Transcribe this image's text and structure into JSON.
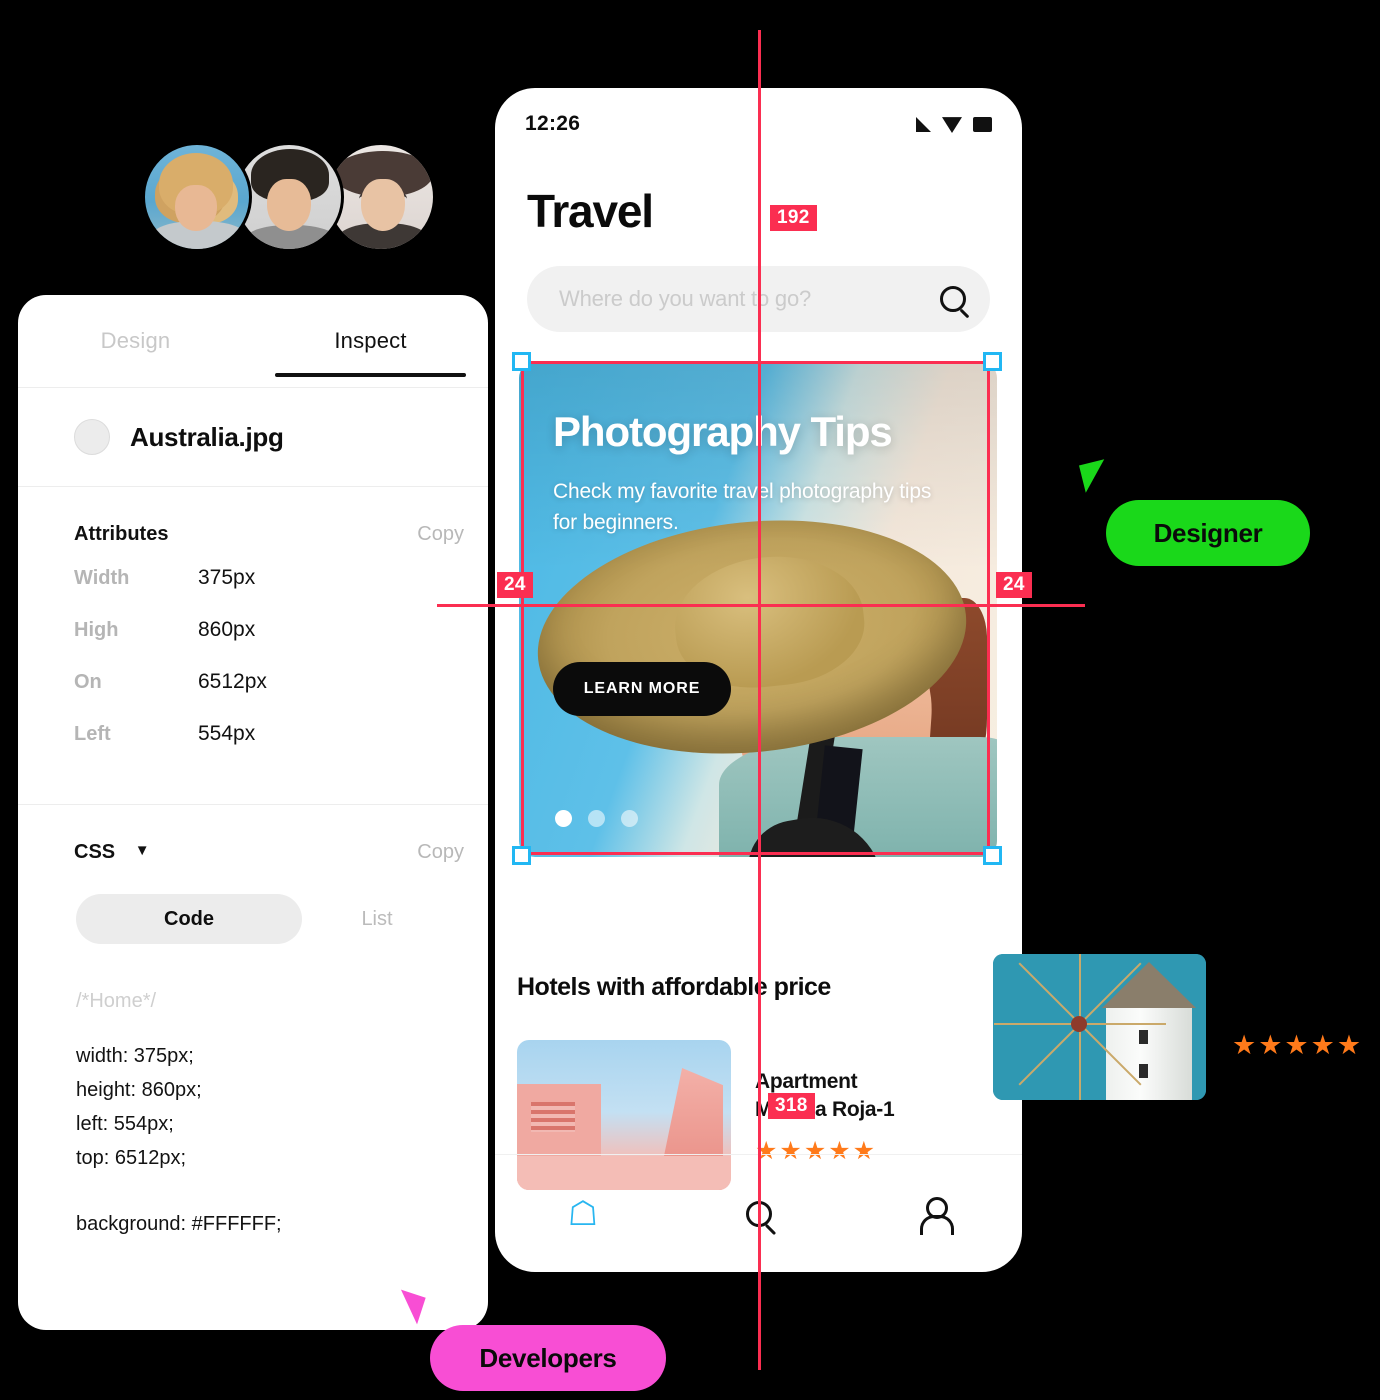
{
  "avatars": [
    {
      "name": "avatar-woman-curly-hair"
    },
    {
      "name": "avatar-man-hat"
    },
    {
      "name": "avatar-woman-glasses-hat"
    }
  ],
  "inspector": {
    "tabs": [
      {
        "label": "Design",
        "active": false
      },
      {
        "label": "Inspect",
        "active": true
      }
    ],
    "file_name": "Australia.jpg",
    "attributes_section": {
      "title": "Attributes",
      "copy_label": "Copy",
      "rows": [
        {
          "key": "Width",
          "value": "375px"
        },
        {
          "key": "High",
          "value": "860px"
        },
        {
          "key": "On",
          "value": "6512px"
        },
        {
          "key": "Left",
          "value": "554px"
        }
      ]
    },
    "css_section": {
      "title": "CSS",
      "caret": "▼",
      "copy_label": "Copy",
      "view_modes": [
        {
          "label": "Code",
          "active": true
        },
        {
          "label": "List",
          "active": false
        }
      ],
      "comment": "/*Home*/",
      "lines": [
        "width: 375px;",
        "height: 860px;",
        "left: 554px;",
        "top: 6512px;"
      ],
      "background_line": "background: #FFFFFF;"
    }
  },
  "phone": {
    "status_bar": {
      "time": "12:26",
      "icons": [
        "signal-icon",
        "wifi-icon",
        "battery-icon"
      ]
    },
    "title": "Travel",
    "search": {
      "placeholder": "Where do you want to go?",
      "icon": "search-icon"
    },
    "hero": {
      "title": "Photography Tips",
      "subtitle": "Check my favorite travel photography tips for beginners.",
      "button_label": "LEARN MORE",
      "carousel_dots": 3,
      "active_dot": 1
    },
    "hotels": {
      "section_title": "Hotels with affordable price",
      "items": [
        {
          "name_line1": "Apartment",
          "name_line2": "Muralla Roja-1",
          "stars": "★★★★★",
          "rating": 5
        }
      ]
    },
    "tabbar": [
      {
        "icon": "home-icon",
        "active": true
      },
      {
        "icon": "search-icon",
        "active": false
      },
      {
        "icon": "user-icon",
        "active": false
      }
    ]
  },
  "measurements": {
    "badges": [
      {
        "id": "192",
        "value": "192"
      },
      {
        "id": "24-left",
        "value": "24"
      },
      {
        "id": "24-right",
        "value": "24"
      },
      {
        "id": "318",
        "value": "318"
      }
    ],
    "guide_color": "#fb2e51",
    "handle_color": "#21b7f3"
  },
  "collaborators": [
    {
      "role": "Designer",
      "color": "#1ad81a"
    },
    {
      "role": "Developers",
      "color": "#f84ed4"
    }
  ],
  "floating": {
    "windmill_card": {
      "name": "windmill-photo"
    },
    "stars": "★★★★★"
  }
}
